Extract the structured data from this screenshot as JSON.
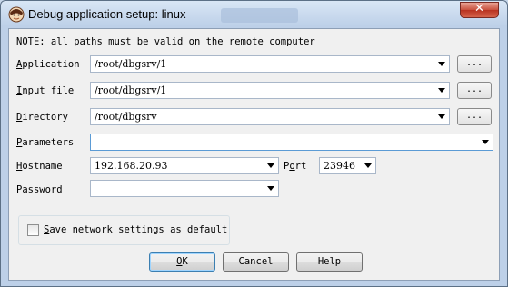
{
  "window": {
    "title": "Debug application setup: linux",
    "background_tab": "",
    "close_glyph": "✕"
  },
  "note": "NOTE: all paths must be valid on the remote computer",
  "fields": {
    "application": {
      "label_key": "A",
      "label_rest": "pplication",
      "value": "/root/dbgsrv/1"
    },
    "input_file": {
      "label_key": "I",
      "label_rest": "nput file",
      "value": "/root/dbgsrv/1"
    },
    "directory": {
      "label_key": "D",
      "label_rest": "irectory",
      "value": "/root/dbgsrv"
    },
    "parameters": {
      "label_key": "P",
      "label_rest": "arameters",
      "value": ""
    },
    "hostname": {
      "label_key": "H",
      "label_rest": "ostname",
      "value": "192.168.20.93"
    },
    "port": {
      "label_key": "o",
      "label_pre": "P",
      "label_rest": "rt",
      "value": "23946"
    },
    "password": {
      "label": "Password",
      "value": ""
    }
  },
  "browse_label": "...",
  "save_settings": {
    "label_key": "S",
    "label_rest": "ave network settings as default",
    "checked": false
  },
  "buttons": {
    "ok": {
      "label_key": "O",
      "label_rest": "K"
    },
    "cancel": "Cancel",
    "help": "Help"
  },
  "icons": {
    "app": "ida-app-icon",
    "close": "close-icon",
    "dropdown": "chevron-down-icon"
  }
}
